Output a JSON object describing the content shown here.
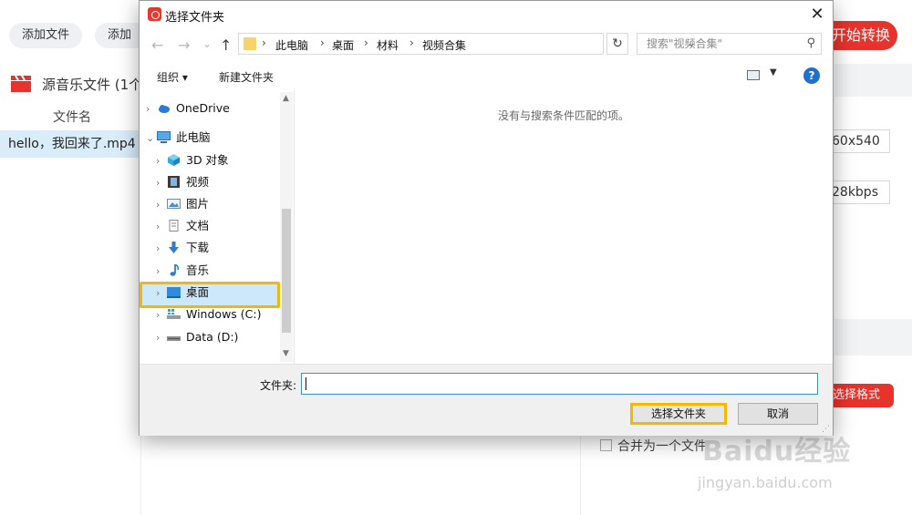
{
  "app": {
    "add_file_btn": "添加文件",
    "add_folder_btn": "添加文",
    "convert_btn": "开始转换",
    "source_title": "源音乐文件 (1个",
    "col_filename": "文件名",
    "file_name": "hello，我回来了.mp4",
    "resolution": "60x540",
    "bitrate": "28kbps",
    "select_format": "选择格式",
    "merge_label": "合并为一个文件"
  },
  "watermark": {
    "logo": "Baidu经验",
    "url": "jingyan.baidu.com"
  },
  "dialog": {
    "title": "选择文件夹",
    "close": "✕",
    "nav": {
      "back": "←",
      "forward": "→",
      "recent": "⌄",
      "up": "↑"
    },
    "breadcrumb": [
      "此电脑",
      "桌面",
      "材料",
      "视频合集"
    ],
    "search_placeholder": "搜索\"视频合集\"",
    "toolbar": {
      "organize": "组织 ▾",
      "new_folder": "新建文件夹"
    },
    "help": "?",
    "tree": [
      {
        "label": "OneDrive",
        "icon": "cloud-icon",
        "indent": 0,
        "expanded": false
      },
      {
        "label": "此电脑",
        "icon": "computer-icon",
        "indent": 0,
        "expanded": true
      },
      {
        "label": "3D 对象",
        "icon": "cube-icon",
        "indent": 1,
        "expanded": false
      },
      {
        "label": "视频",
        "icon": "film-icon",
        "indent": 1,
        "expanded": false
      },
      {
        "label": "图片",
        "icon": "picture-icon",
        "indent": 1,
        "expanded": false
      },
      {
        "label": "文档",
        "icon": "document-icon",
        "indent": 1,
        "expanded": false
      },
      {
        "label": "下载",
        "icon": "download-icon",
        "indent": 1,
        "expanded": false
      },
      {
        "label": "音乐",
        "icon": "music-icon",
        "indent": 1,
        "expanded": false
      },
      {
        "label": "桌面",
        "icon": "desktop-icon",
        "indent": 1,
        "expanded": false,
        "selected": true
      },
      {
        "label": "Windows (C:)",
        "icon": "drive-c-icon",
        "indent": 1,
        "expanded": false
      },
      {
        "label": "Data (D:)",
        "icon": "drive-d-icon",
        "indent": 1,
        "expanded": false
      }
    ],
    "empty_message": "没有与搜索条件匹配的项。",
    "folder_label": "文件夹:",
    "folder_value": "",
    "choose_btn": "选择文件夹",
    "cancel_btn": "取消"
  },
  "colors": {
    "accent_red": "#e8322c",
    "highlight": "#f4b800",
    "selection": "#cde8fb"
  }
}
